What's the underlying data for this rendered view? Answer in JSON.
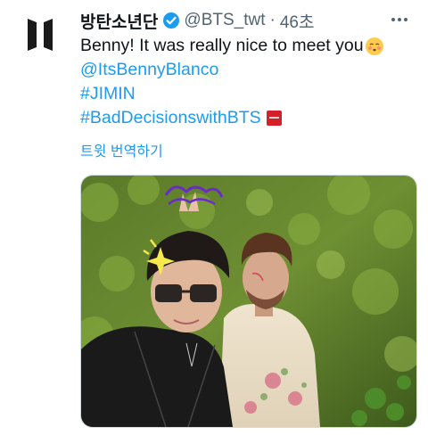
{
  "tweet": {
    "display_name": "방탄소년단",
    "handle": "@BTS_twt",
    "separator": "·",
    "time": "46초",
    "text_line1": "Benny! It was really nice to meet you",
    "mention": "@ItsBennyBlanco",
    "hashtag1": "#JIMIN",
    "hashtag2": "#BadDecisionswithBTS",
    "translate_label": "트윗 번역하기"
  },
  "colors": {
    "link": "#1d9bf0",
    "verified": "#1d9bf0",
    "text": "#0f1419",
    "secondary": "#536471"
  },
  "icons": {
    "avatar": "bts-logo-icon",
    "verified": "verified-badge-icon",
    "more": "more-options-icon",
    "emoji": "kissing-face-emoji",
    "flag": "bad-decisions-emoji"
  }
}
